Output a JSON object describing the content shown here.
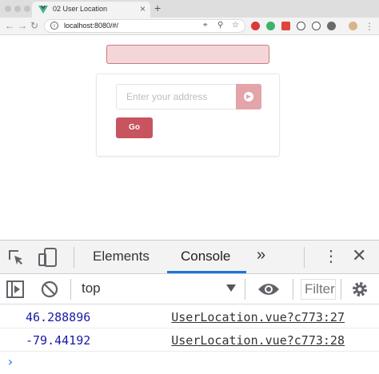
{
  "browser": {
    "tab_title": "02 User Location",
    "tab_close": "×",
    "new_tab": "+",
    "url": "localhost:8080/#/",
    "brand_color": "#41b883"
  },
  "app": {
    "address_placeholder": "Enter your address",
    "go_label": "Go",
    "accent_color": "#c8545f"
  },
  "devtools": {
    "tabs": [
      {
        "label": "Elements",
        "active": false
      },
      {
        "label": "Console",
        "active": true
      }
    ],
    "more_tabs": "»",
    "context": "top",
    "filter_placeholder": "Filter",
    "logs": [
      {
        "value": "46.288896",
        "source": "UserLocation.vue?c773:27"
      },
      {
        "value": "-79.44192",
        "source": "UserLocation.vue?c773:28"
      }
    ],
    "prompt": "›"
  }
}
